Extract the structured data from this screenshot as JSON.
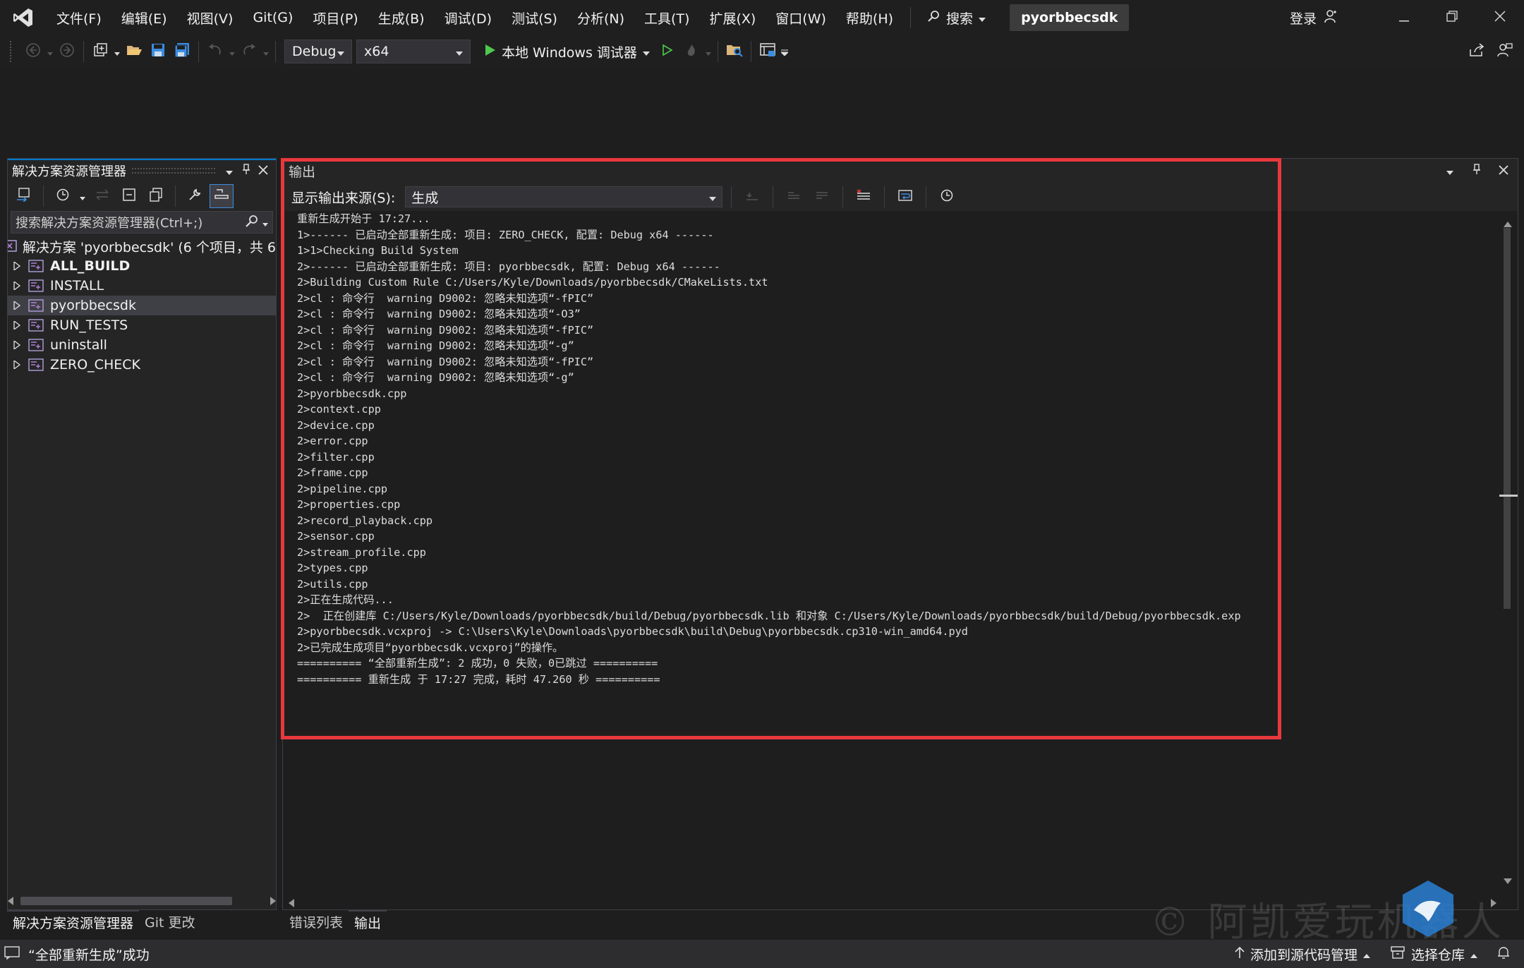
{
  "menu": {
    "items": [
      "文件(F)",
      "编辑(E)",
      "视图(V)",
      "Git(G)",
      "项目(P)",
      "生成(B)",
      "调试(D)",
      "测试(S)",
      "分析(N)",
      "工具(T)",
      "扩展(X)",
      "窗口(W)",
      "帮助(H)"
    ],
    "search_label": "搜索",
    "solution_name": "pyorbbecsdk",
    "signin_label": "登录"
  },
  "toolbar": {
    "config_value": "Debug",
    "platform_value": "x64",
    "run_label": "本地 Windows 调试器"
  },
  "solution_explorer": {
    "title": "解决方案资源管理器",
    "search_placeholder": "搜索解决方案资源管理器(Ctrl+;)",
    "solution_row": "解决方案 'pyorbbecsdk' (6 个项目，共 6",
    "projects": [
      {
        "name": "ALL_BUILD",
        "bold": true
      },
      {
        "name": "INSTALL",
        "bold": false
      },
      {
        "name": "pyorbbecsdk",
        "bold": false,
        "selected": true
      },
      {
        "name": "RUN_TESTS",
        "bold": false
      },
      {
        "name": "uninstall",
        "bold": false
      },
      {
        "name": "ZERO_CHECK",
        "bold": false
      }
    ],
    "tabs": [
      "解决方案资源管理器",
      "Git 更改"
    ]
  },
  "output": {
    "title": "输出",
    "source_label": "显示输出来源(S):",
    "source_value": "生成",
    "lines": [
      "重新生成开始于 17:27...",
      "1>------ 已启动全部重新生成: 项目: ZERO_CHECK, 配置: Debug x64 ------",
      "1>1>Checking Build System",
      "2>------ 已启动全部重新生成: 项目: pyorbbecsdk, 配置: Debug x64 ------",
      "2>Building Custom Rule C:/Users/Kyle/Downloads/pyorbbecsdk/CMakeLists.txt",
      "2>cl : 命令行  warning D9002: 忽略未知选项“-fPIC”",
      "2>cl : 命令行  warning D9002: 忽略未知选项“-O3”",
      "2>cl : 命令行  warning D9002: 忽略未知选项“-fPIC”",
      "2>cl : 命令行  warning D9002: 忽略未知选项“-g”",
      "2>cl : 命令行  warning D9002: 忽略未知选项“-fPIC”",
      "2>cl : 命令行  warning D9002: 忽略未知选项“-g”",
      "2>pyorbbecsdk.cpp",
      "2>context.cpp",
      "2>device.cpp",
      "2>error.cpp",
      "2>filter.cpp",
      "2>frame.cpp",
      "2>pipeline.cpp",
      "2>properties.cpp",
      "2>record_playback.cpp",
      "2>sensor.cpp",
      "2>stream_profile.cpp",
      "2>types.cpp",
      "2>utils.cpp",
      "2>正在生成代码...",
      "2>  正在创建库 C:/Users/Kyle/Downloads/pyorbbecsdk/build/Debug/pyorbbecsdk.lib 和对象 C:/Users/Kyle/Downloads/pyorbbecsdk/build/Debug/pyorbbecsdk.exp",
      "2>pyorbbecsdk.vcxproj -> C:\\Users\\Kyle\\Downloads\\pyorbbecsdk\\build\\Debug\\pyorbbecsdk.cp310-win_amd64.pyd",
      "2>已完成生成项目“pyorbbecsdk.vcxproj”的操作。",
      "========== “全部重新生成”: 2 成功，0 失败，0已跳过 ==========",
      "========== 重新生成 于 17:27 完成，耗时 47.260 秒 =========="
    ],
    "tabs": [
      "错误列表",
      "输出"
    ]
  },
  "status": {
    "message": "“全部重新生成”成功",
    "add_source_control": "添加到源代码管理",
    "select_repo": "选择仓库"
  },
  "watermark": "© 阿凯爱玩机器人",
  "colors": {
    "accent": "#007acc",
    "highlight_border": "#e8383d",
    "run_green": "#4ec94e"
  }
}
